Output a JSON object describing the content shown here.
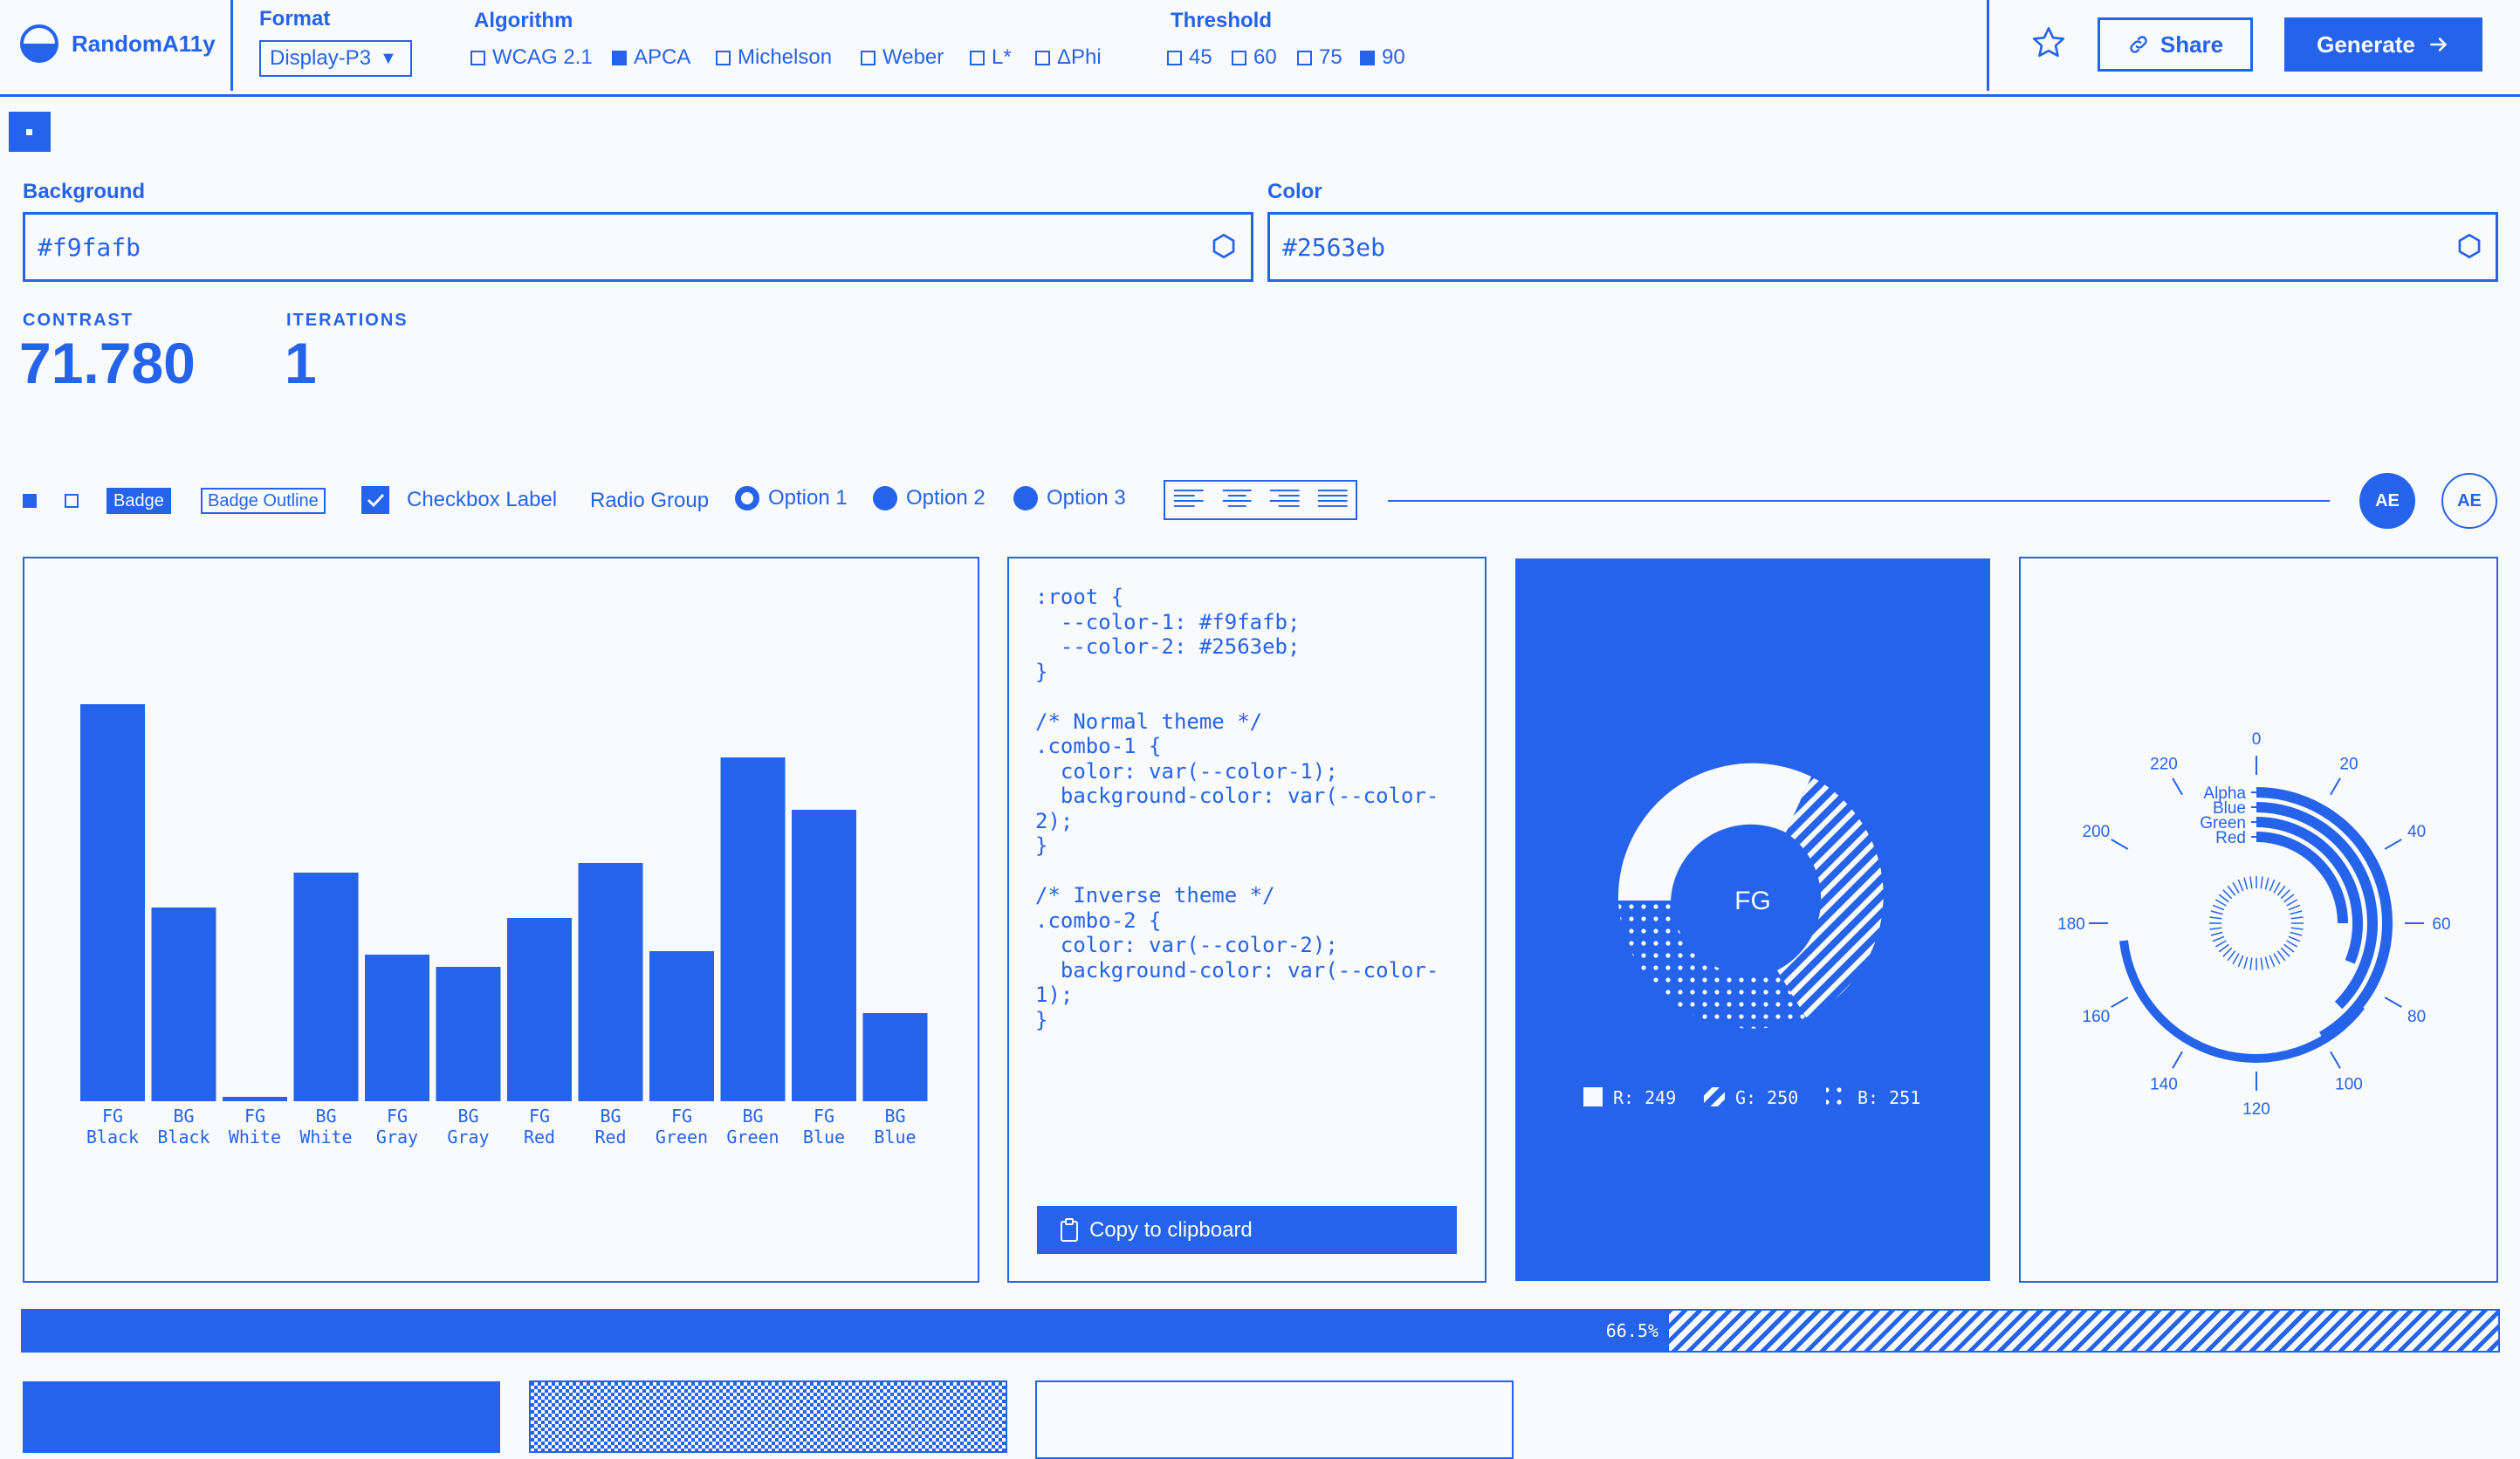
{
  "app": {
    "title": "RandomA11y"
  },
  "format": {
    "label": "Format",
    "value": "Display-P3"
  },
  "algorithm": {
    "label": "Algorithm",
    "options": [
      {
        "label": "WCAG 2.1",
        "checked": false
      },
      {
        "label": "APCA",
        "checked": true
      },
      {
        "label": "Michelson",
        "checked": false
      },
      {
        "label": "Weber",
        "checked": false
      },
      {
        "label": "L*",
        "checked": false
      },
      {
        "label": "ΔPhi",
        "checked": false
      }
    ]
  },
  "threshold": {
    "label": "Threshold",
    "options": [
      {
        "label": "45",
        "checked": false
      },
      {
        "label": "60",
        "checked": false
      },
      {
        "label": "75",
        "checked": false
      },
      {
        "label": "90",
        "checked": true
      }
    ]
  },
  "actions": {
    "share": "Share",
    "generate": "Generate"
  },
  "fields": {
    "background": {
      "label": "Background",
      "value": "#f9fafb"
    },
    "color": {
      "label": "Color",
      "value": "#2563eb"
    }
  },
  "stats": {
    "contrast_label": "CONTRAST",
    "contrast_value": "71.780",
    "iterations_label": "ITERATIONS",
    "iterations_value": "1"
  },
  "controls": {
    "badge": "Badge",
    "badge_outline": "Badge Outline",
    "checkbox_label": "Checkbox Label",
    "radio_group": "Radio Group",
    "radio_options": [
      "Option 1",
      "Option 2",
      "Option 3"
    ],
    "avatars": [
      "AE",
      "AE"
    ]
  },
  "code": {
    "lines": [
      ":root {",
      "  --color-1: #f9fafb;",
      "  --color-2: #2563eb;",
      "}",
      "",
      "/* Normal theme */",
      ".combo-1 {",
      "  color: var(--color-1);",
      "  background-color: var(--color-",
      "2);",
      "}",
      "",
      "/* Inverse theme */",
      ".combo-2 {",
      "  color: var(--color-2);",
      "  background-color: var(--color-",
      "1);",
      "}"
    ],
    "copy_label": "Copy to clipboard"
  },
  "donut": {
    "label": "FG",
    "legend": [
      "R: 249",
      "G: 250",
      "B: 251"
    ]
  },
  "radial": {
    "series": [
      "Alpha",
      "Blue",
      "Green",
      "Red"
    ],
    "ticks": [
      "0",
      "20",
      "40",
      "60",
      "80",
      "100",
      "120",
      "140",
      "160",
      "180",
      "200",
      "220"
    ]
  },
  "progress": {
    "label": "66.5%",
    "value": 0.665
  },
  "colors": {
    "accent": "#2563eb",
    "background": "#f9fafb"
  },
  "chart_data": {
    "type": "bar",
    "categories": [
      "FG Black",
      "BG Black",
      "FG White",
      "BG White",
      "FG Gray",
      "BG Gray",
      "FG Red",
      "BG Red",
      "FG Green",
      "BG Green",
      "FG Blue",
      "BG Blue"
    ],
    "values": [
      455,
      222,
      5,
      262,
      168,
      154,
      210,
      273,
      172,
      394,
      334,
      101
    ],
    "ylim": [
      0,
      480
    ]
  }
}
